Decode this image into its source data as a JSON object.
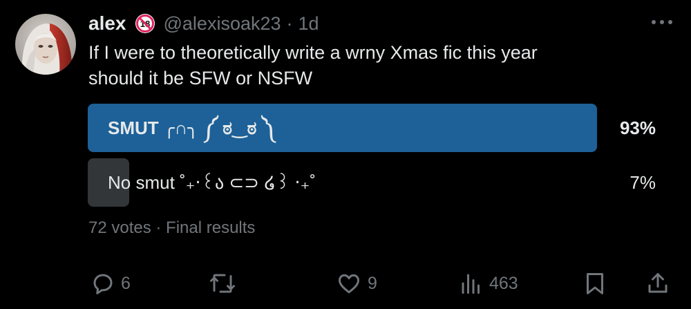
{
  "author": {
    "display_name": "alex",
    "badge_icon": "no-under-18-icon",
    "handle": "@alexisoak23",
    "separator": "·",
    "time": "1d"
  },
  "tweet": {
    "text": "If I were to theoretically write a wrny Xmas fic this year\nshould it be SFW or NSFW"
  },
  "poll": {
    "options": [
      {
        "label": "SMUT ╭∩╮ ༼ ಠ‿ಠ ༽",
        "percent_label": "93%",
        "percent": 93,
        "winner": true
      },
      {
        "label": "No smut ˚₊‧꒰ა ⊂⊃ ໒꒱ ‧₊˚",
        "percent_label": "7%",
        "percent": 7,
        "winner": false
      }
    ],
    "footer": "72 votes · Final results"
  },
  "actions": {
    "reply_count": "6",
    "retweet_count": "",
    "like_count": "9",
    "views_count": "463"
  },
  "colors": {
    "background": "#000000",
    "winner_bar": "#1d6198",
    "loser_bar": "#333639",
    "muted_text": "#71767b",
    "primary_text": "#e7e9ea"
  }
}
